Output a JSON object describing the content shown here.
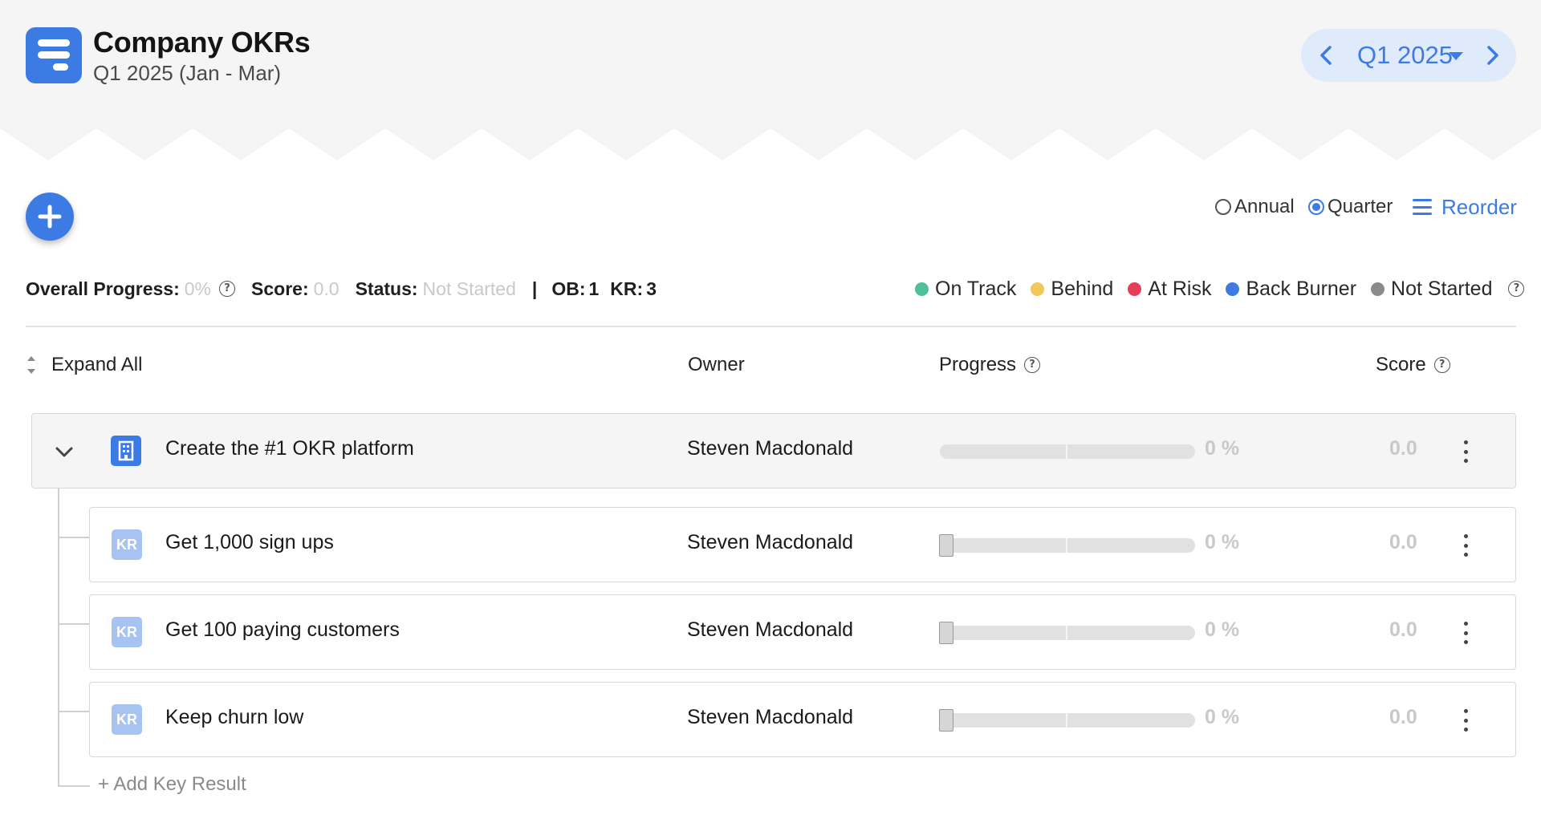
{
  "header": {
    "title": "Company OKRs",
    "subtitle": "Q1 2025 (Jan - Mar)",
    "logo_icon": "stacked-bars-logo-icon",
    "quarter_picker": {
      "label": "Q1 2025",
      "prev_icon": "chevron-left-icon",
      "next_icon": "chevron-right-icon",
      "caret_icon": "caret-down-icon"
    }
  },
  "toolbar": {
    "add_icon": "plus-icon",
    "view_options": [
      {
        "label": "Annual",
        "checked": false
      },
      {
        "label": "Quarter",
        "checked": true
      }
    ],
    "reorder_label": "Reorder",
    "reorder_icon": "list-icon"
  },
  "summary": {
    "overall_progress_label": "Overall Progress:",
    "overall_progress_value": "0%",
    "score_label": "Score:",
    "score_value": "0.0",
    "status_label": "Status:",
    "status_value": "Not Started",
    "separator": "|",
    "ob_label": "OB:",
    "ob_value": "1",
    "kr_label": "KR:",
    "kr_value": "3"
  },
  "legend": [
    {
      "label": "On Track",
      "color": "#4fbf9c"
    },
    {
      "label": "Behind",
      "color": "#f2c85b"
    },
    {
      "label": "At Risk",
      "color": "#e43f5a"
    },
    {
      "label": "Back Burner",
      "color": "#3d7be4"
    },
    {
      "label": "Not Started",
      "color": "#8a8a8a"
    }
  ],
  "columns": {
    "expand_all": "Expand All",
    "owner": "Owner",
    "progress": "Progress",
    "score": "Score"
  },
  "objective": {
    "title": "Create the #1 OKR platform",
    "owner": "Steven Macdonald",
    "progress": 0,
    "progress_text": "0 %",
    "score": "0.0",
    "icon": "building-icon"
  },
  "key_results": [
    {
      "badge": "KR",
      "title": "Get 1,000 sign ups",
      "owner": "Steven Macdonald",
      "progress": 0,
      "progress_text": "0 %",
      "score": "0.0"
    },
    {
      "badge": "KR",
      "title": "Get 100 paying customers",
      "owner": "Steven Macdonald",
      "progress": 0,
      "progress_text": "0 %",
      "score": "0.0"
    },
    {
      "badge": "KR",
      "title": "Keep churn low",
      "owner": "Steven Macdonald",
      "progress": 0,
      "progress_text": "0 %",
      "score": "0.0"
    }
  ],
  "add_key_result_label": "+ Add Key Result",
  "colors": {
    "accent": "#3d7be4",
    "accent_light": "#dfeafa",
    "kr_badge": "#a7c3f1",
    "muted_value": "#c9c9c9"
  }
}
